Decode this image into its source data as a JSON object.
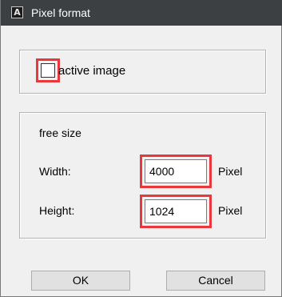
{
  "window": {
    "title": "Pixel format",
    "app_icon": {
      "name": "app-icon",
      "glyph": "A"
    }
  },
  "active_group": {
    "checkbox_label": "active image",
    "checked": false
  },
  "size_group": {
    "section_label": "free size",
    "width": {
      "label": "Width:",
      "value": "4000",
      "unit": "Pixel"
    },
    "height": {
      "label": "Height:",
      "value": "1024",
      "unit": "Pixel"
    }
  },
  "buttons": {
    "ok": "OK",
    "cancel": "Cancel"
  },
  "colors": {
    "titlebar": "#3c4043",
    "highlight": "#e8383d",
    "background": "#f0f0f0"
  }
}
